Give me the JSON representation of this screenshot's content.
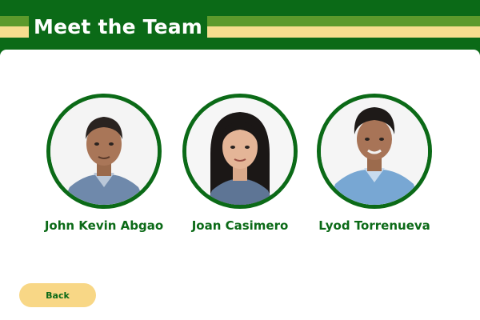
{
  "header": {
    "title": "Meet the Team"
  },
  "team": {
    "members": [
      {
        "name": "John Kevin Abgao"
      },
      {
        "name": "Joan Casimero"
      },
      {
        "name": "Lyod Torrenueva"
      }
    ]
  },
  "actions": {
    "back_label": "Back"
  },
  "colors": {
    "brand_green": "#0b6a17",
    "olive_stripe": "#5c9a2c",
    "cream_stripe": "#f6dd8e",
    "button_yellow": "#f8d786"
  }
}
